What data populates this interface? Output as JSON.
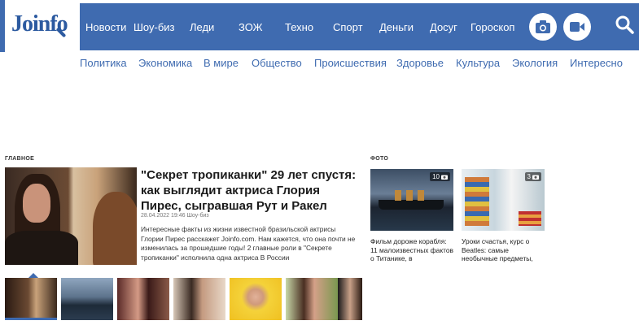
{
  "logo": {
    "text_before": "Jo",
    "text_o": "i",
    "text_after": "nfo"
  },
  "topnav": {
    "items": [
      "Новости",
      "Шоу-биз",
      "Леди",
      "ЗОЖ",
      "Техно",
      "Спорт",
      "Деньги",
      "Досуг",
      "Гороскоп"
    ]
  },
  "subnav": {
    "items": [
      "Политика",
      "Экономика",
      "В мире",
      "Общество",
      "Происшествия",
      "Здоровье",
      "Культура",
      "Экология",
      "Интересно"
    ]
  },
  "main_section": {
    "label": "ГЛАВНОЕ",
    "title": "\"Секрет тропиканки\" 29 лет спустя: как выглядит актриса Глория Пирес, сыгравшая Рут и Ракел",
    "meta": "28.04.2022 19:46 Шоу-биз",
    "text": "Интересные факты из жизни известной бразильской актрисы Глории Пирес расскажет Joinfo.com. Нам кажется, что она почти не изменилась за прошедшие годы! 2 главные роли в \"Секрете тропиканки\" исполнила одна актриса В России"
  },
  "photo_section": {
    "label": "ФОТО",
    "cards": [
      {
        "count": "10",
        "caption": "Фильм дороже корабля: 11 малоизвестных фактов о Титанике, в"
      },
      {
        "count": "3",
        "caption": "Уроки счастья, курс о Beatles: самые необычные предметы,"
      }
    ]
  },
  "colors": {
    "brand": "#3f6bb0",
    "nav_text": "#ffffff"
  },
  "icons": [
    "camera-icon",
    "video-icon",
    "search-icon",
    "magnifier-logo-icon"
  ]
}
